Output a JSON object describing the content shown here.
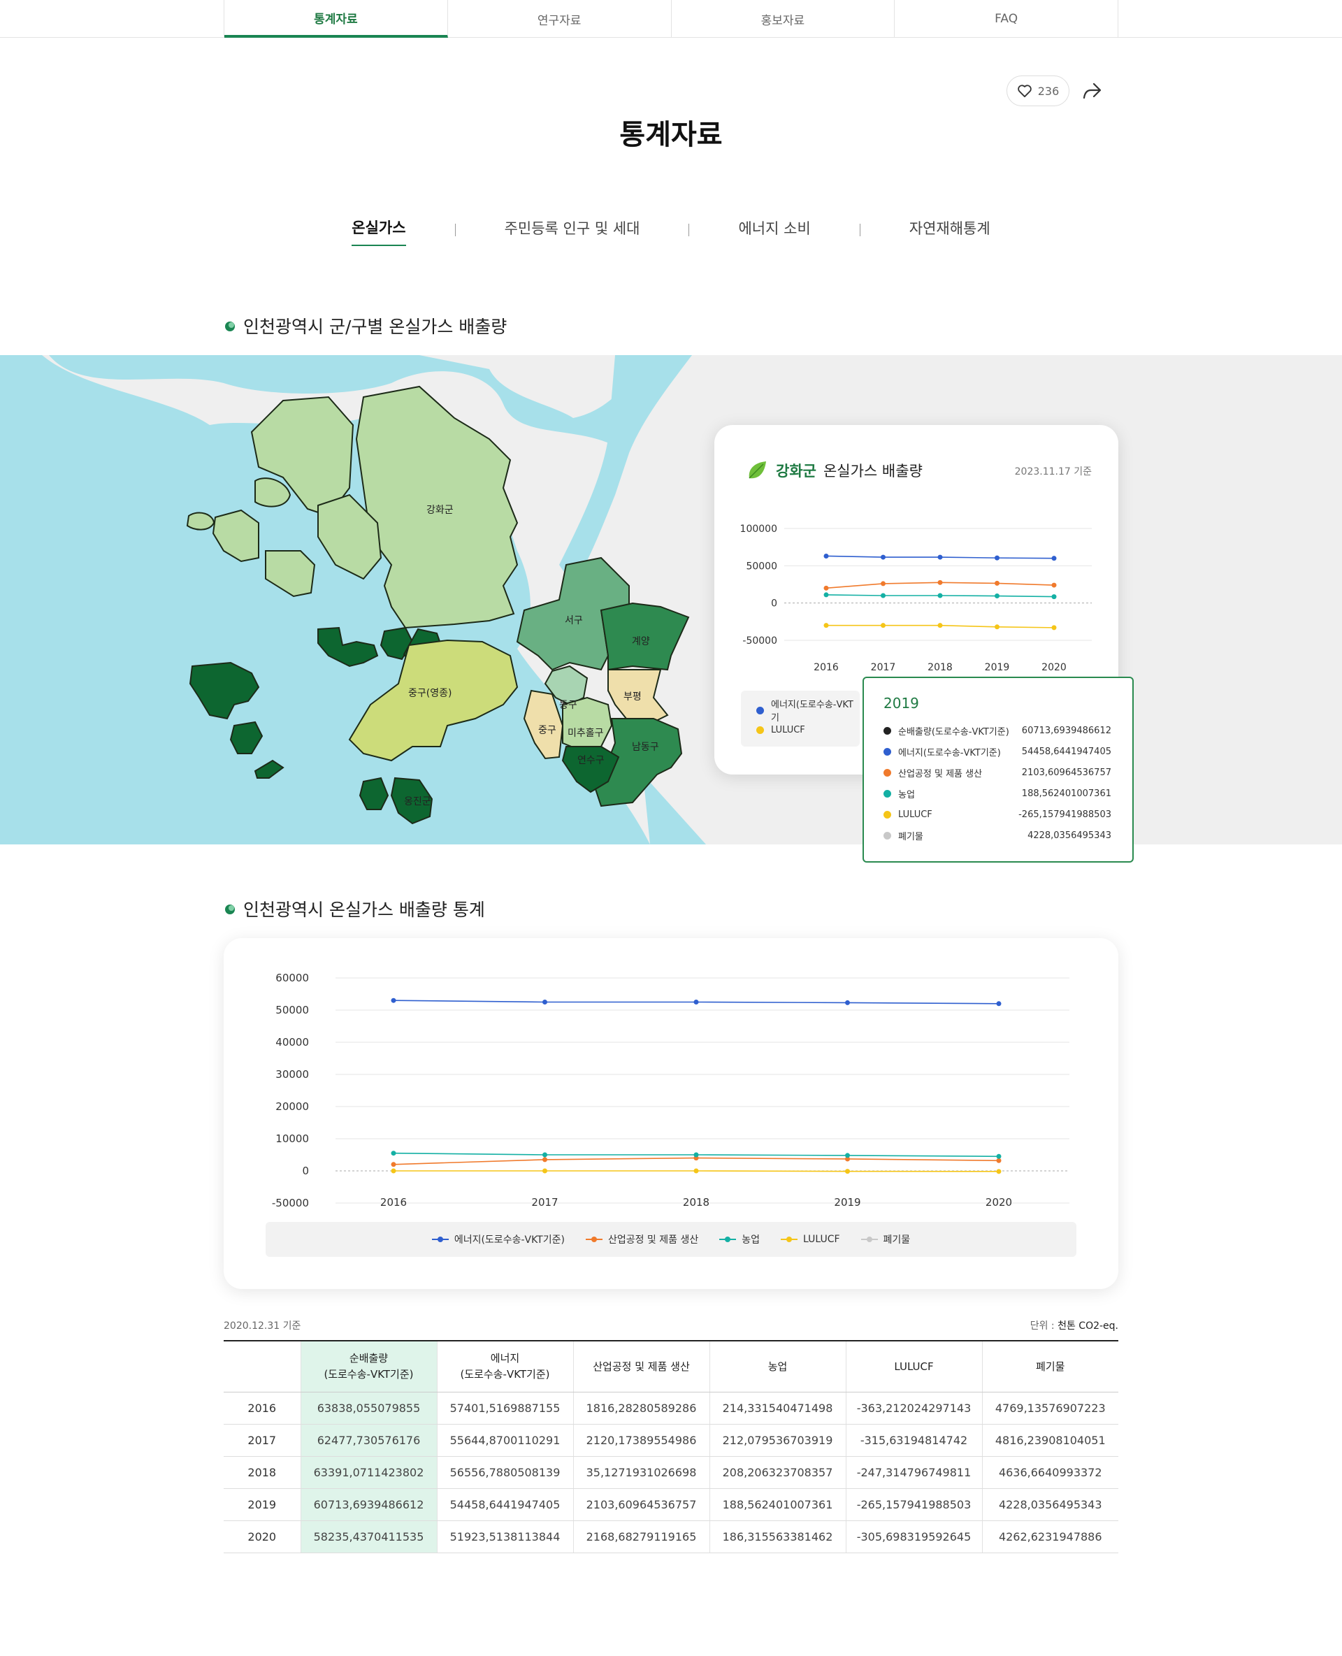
{
  "top_tabs": [
    "통계자료",
    "연구자료",
    "홍보자료",
    "FAQ"
  ],
  "likes": "236",
  "page_title": "통계자료",
  "categories": [
    "온실가스",
    "주민등록 인구 및 세대",
    "에너지 소비",
    "자연재해통계"
  ],
  "section1_title": "인천광역시 군/구별 온실가스 배출량",
  "section2_title": "인천광역시 온실가스 배출량 통계",
  "map_regions": [
    "강화군",
    "서구",
    "계양",
    "부평",
    "동구",
    "중구",
    "미추홀구",
    "남동구",
    "연수구",
    "중구(영종)",
    "옹진군"
  ],
  "popup": {
    "region": "강화군",
    "title_suffix": "온실가스 배출량",
    "date": "2023.11.17 기준",
    "legend": [
      "에너지(도로수송-VKT기",
      "LULUCF"
    ]
  },
  "tooltip": {
    "year": "2019",
    "rows": [
      {
        "label": "순배출량(도로수송-VKT기준)",
        "value": "60713,6939486612",
        "color": "#222222"
      },
      {
        "label": "에너지(도로수송-VKT기준)",
        "value": "54458,6441947405",
        "color": "#2f5fcf"
      },
      {
        "label": "산업공정 및 제품 생산",
        "value": "2103,60964536757",
        "color": "#f07a2c"
      },
      {
        "label": "농업",
        "value": "188,562401007361",
        "color": "#14b0a4"
      },
      {
        "label": "LULUCF",
        "value": "-265,157941988503",
        "color": "#f5c518"
      },
      {
        "label": "폐기물",
        "value": "4228,0356495343",
        "color": "#c8c8c8"
      }
    ]
  },
  "chart_data": [
    {
      "type": "line",
      "title": "강화군 온실가스 배출량",
      "x": [
        "2016",
        "2017",
        "2018",
        "2019",
        "2020"
      ],
      "ylim": [
        -50000,
        100000
      ],
      "yticks": [
        "100000",
        "50000",
        "0",
        "-50000"
      ],
      "series": [
        {
          "name": "에너지(도로수송-VKT기",
          "color": "#2f5fcf",
          "values": [
            63000,
            61500,
            61500,
            60500,
            60000
          ]
        },
        {
          "color": "#f07a2c",
          "values": [
            20000,
            26000,
            27500,
            26500,
            24000
          ]
        },
        {
          "color": "#14b0a4",
          "values": [
            11000,
            10000,
            10000,
            9500,
            8500
          ]
        },
        {
          "name": "LULUCF",
          "color": "#f5c518",
          "values": [
            -30000,
            -30000,
            -30000,
            -32000,
            -33000
          ]
        }
      ]
    },
    {
      "type": "line",
      "x": [
        "2016",
        "2017",
        "2018",
        "2019",
        "2020"
      ],
      "ylim": [
        -50000,
        60000
      ],
      "yticks": [
        "60000",
        "50000",
        "40000",
        "30000",
        "20000",
        "10000",
        "0",
        "-50000"
      ],
      "series": [
        {
          "name": "에너지(도로수송-VKT기준)",
          "color": "#2f5fcf",
          "values": [
            53000,
            52500,
            52500,
            52300,
            52000
          ]
        },
        {
          "name": "산업공정 및 제품 생산",
          "color": "#f07a2c",
          "values": [
            2000,
            3500,
            4000,
            3700,
            3200
          ]
        },
        {
          "name": "농업",
          "color": "#14b0a4",
          "values": [
            5500,
            5000,
            5000,
            4800,
            4500
          ]
        },
        {
          "name": "LULUCF",
          "color": "#f5c518",
          "values": [
            0,
            0,
            0,
            -700,
            -900
          ]
        },
        {
          "name": "폐기물",
          "color": "#c8c8c8",
          "values": []
        }
      ]
    }
  ],
  "table": {
    "basis": "2020.12.31 기준",
    "unit_label": "단위 :",
    "unit": "천톤 CO2-eq.",
    "headers": [
      [
        "",
        ""
      ],
      [
        "순배출량",
        "(도로수송-VKT기준)"
      ],
      [
        "에너지",
        "(도로수송-VKT기준)"
      ],
      [
        "산업공정 및 제품 생산",
        ""
      ],
      [
        "농업",
        ""
      ],
      [
        "LULUCF",
        ""
      ],
      [
        "폐기물",
        ""
      ]
    ],
    "rows": [
      [
        "2016",
        "63838,055079855",
        "57401,5169887155",
        "1816,28280589286",
        "214,331540471498",
        "-363,212024297143",
        "4769,13576907223"
      ],
      [
        "2017",
        "62477,730576176",
        "55644,8700110291",
        "2120,17389554986",
        "212,079536703919",
        "-315,63194814742",
        "4816,23908104051"
      ],
      [
        "2018",
        "63391,0711423802",
        "56556,7880508139",
        "35,1271931026698",
        "208,206323708357",
        "-247,314796749811",
        "4636,6640993372"
      ],
      [
        "2019",
        "60713,6939486612",
        "54458,6441947405",
        "2103,60964536757",
        "188,562401007361",
        "-265,157941988503",
        "4228,0356495343"
      ],
      [
        "2020",
        "58235,4370411535",
        "51923,5138113844",
        "2168,68279119165",
        "186,315563381462",
        "-305,698319592645",
        "4262,6231947886"
      ]
    ]
  }
}
